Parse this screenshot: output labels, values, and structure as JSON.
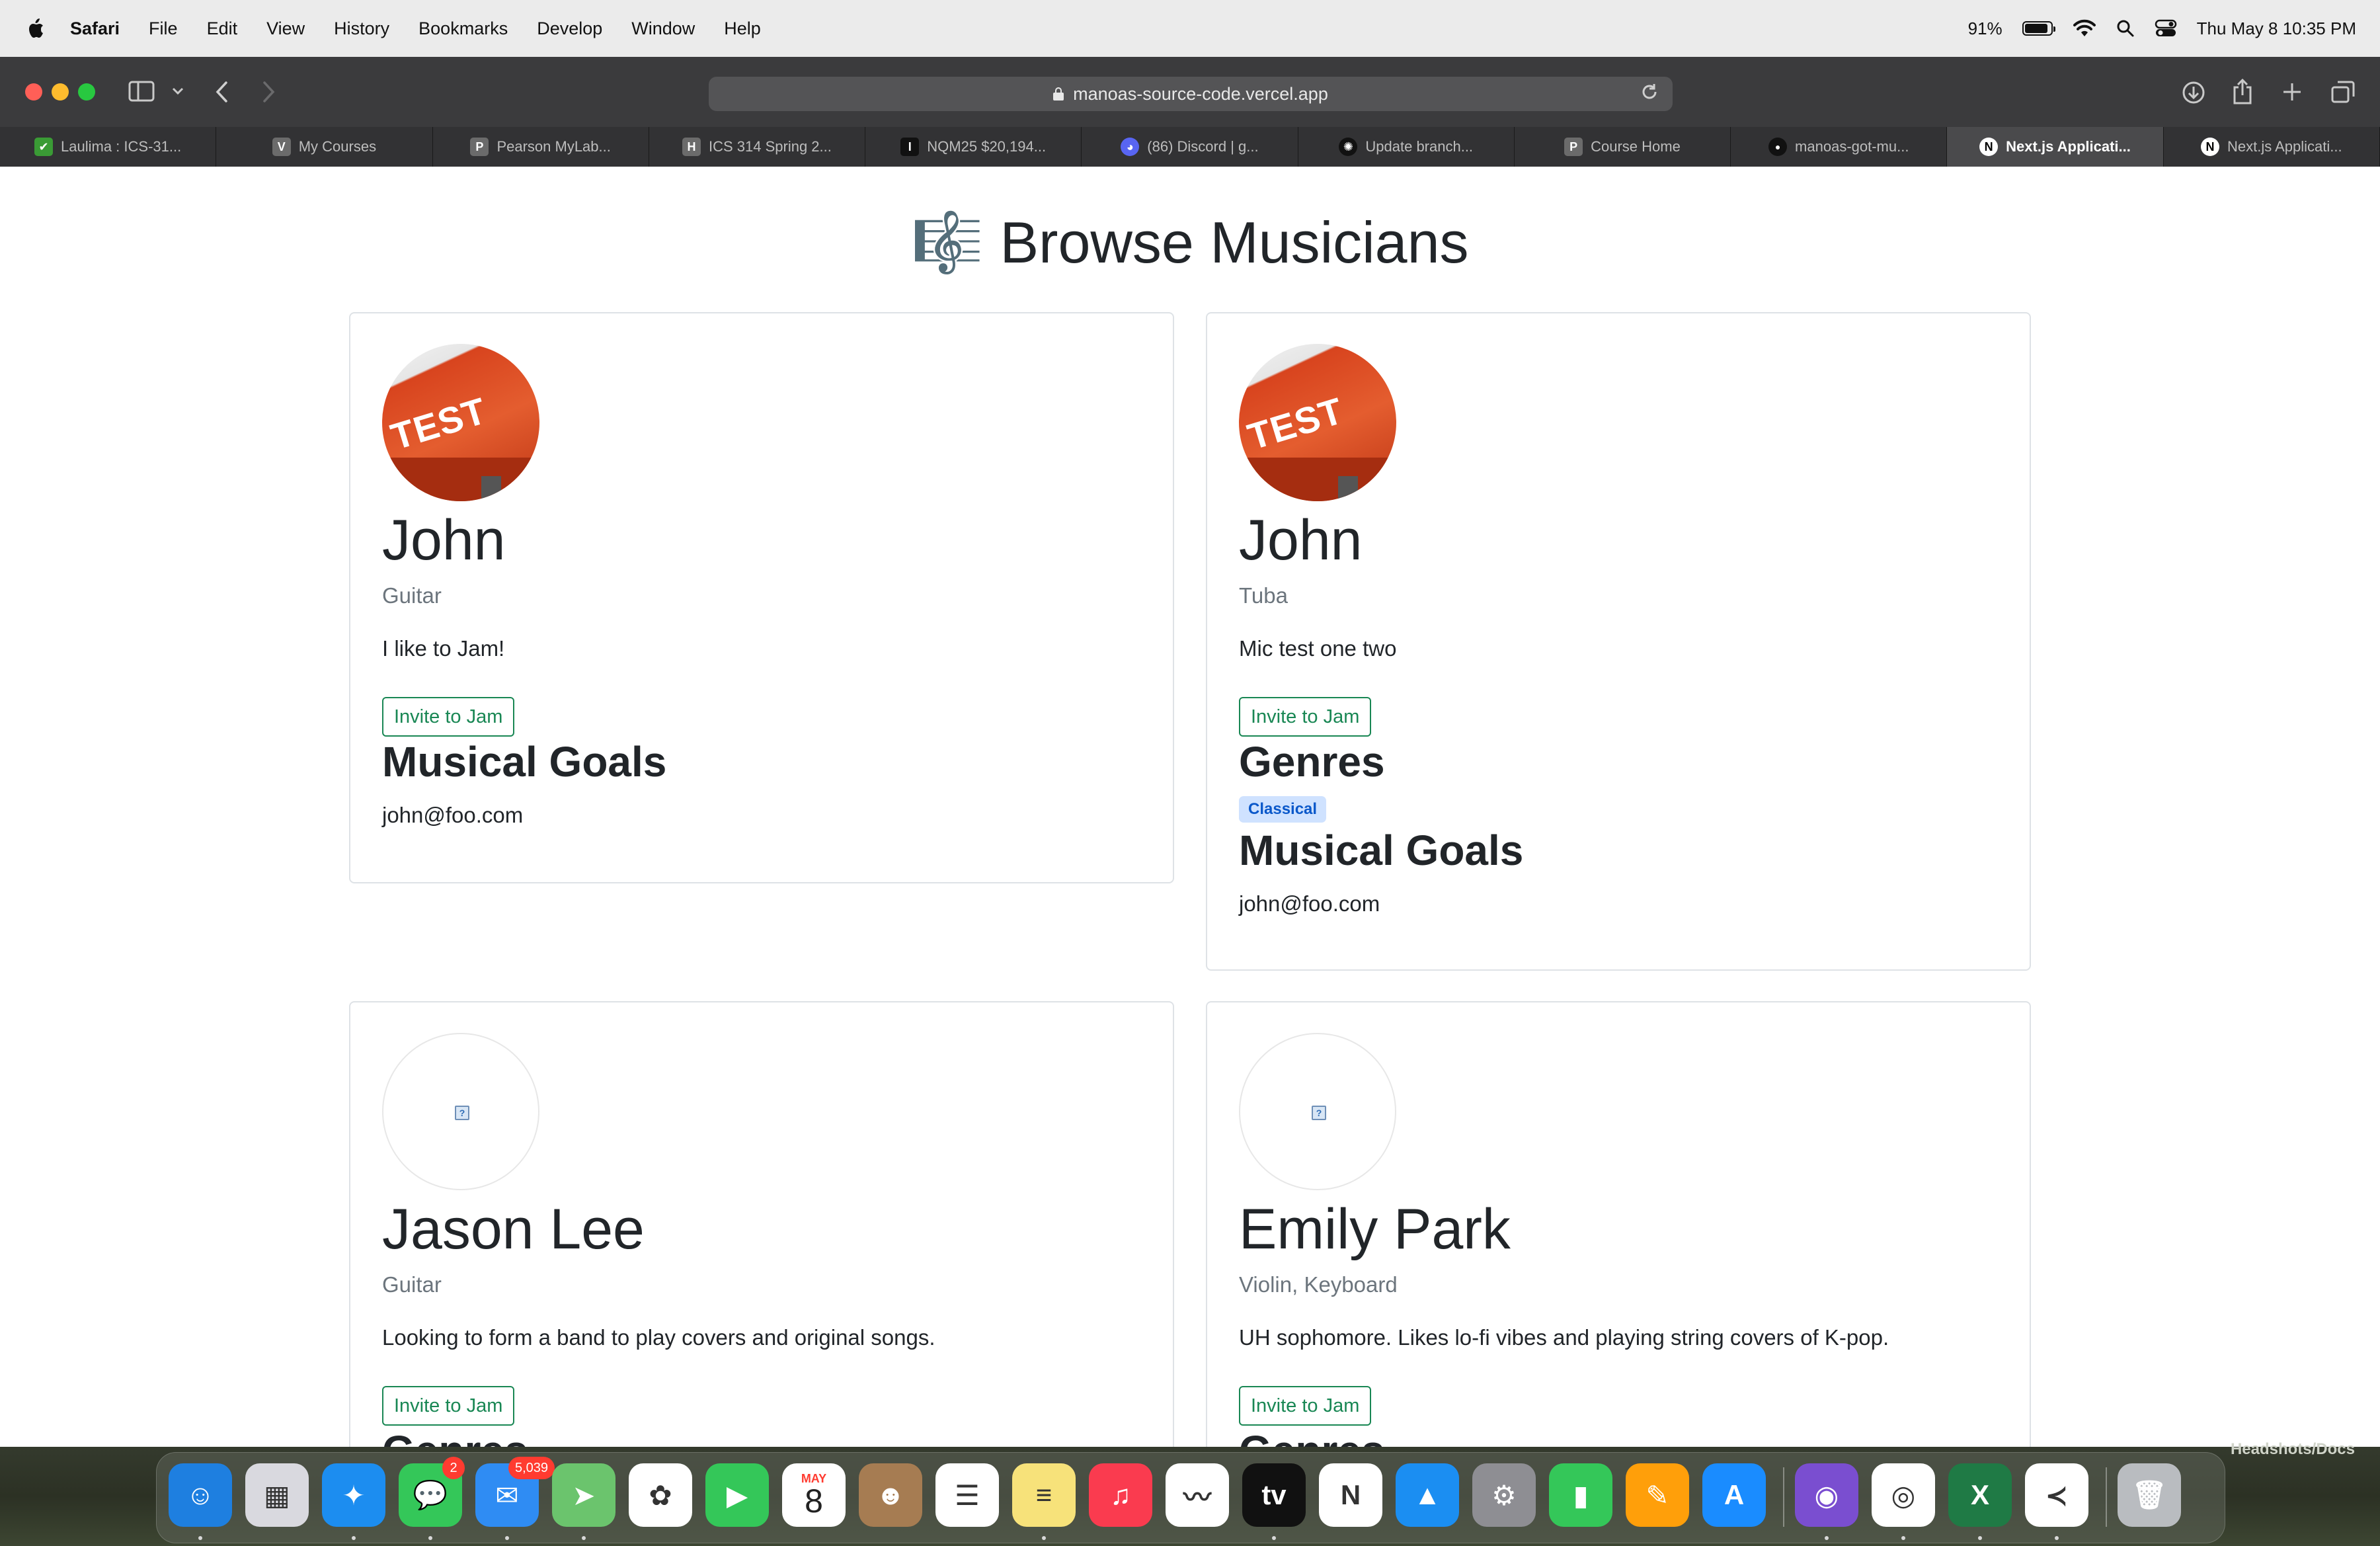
{
  "menubar": {
    "items": [
      "Safari",
      "File",
      "Edit",
      "View",
      "History",
      "Bookmarks",
      "Develop",
      "Window",
      "Help"
    ],
    "battery_percent": "91%",
    "battery_level": 0.91,
    "datetime": "Thu May 8  10:35 PM"
  },
  "browser": {
    "url": "manoas-source-code.vercel.app",
    "tabs": [
      {
        "label": "Laulima : ICS-31...",
        "icon": "leaf-icon",
        "color": "#3a9b35"
      },
      {
        "label": "My Courses",
        "icon": "V",
        "color": "#6b6b6b"
      },
      {
        "label": "Pearson MyLab...",
        "icon": "P",
        "color": "#6b6b6b"
      },
      {
        "label": "ICS 314 Spring 2...",
        "icon": "H",
        "color": "#6b6b6b"
      },
      {
        "label": "NQM25 $20,194...",
        "icon": "I",
        "color": "#111111"
      },
      {
        "label": "(86) Discord | g...",
        "icon": "discord-icon",
        "color": "#5865f2"
      },
      {
        "label": "Update branch...",
        "icon": "openai-icon",
        "color": "#111111"
      },
      {
        "label": "Course Home",
        "icon": "P",
        "color": "#6b6b6b"
      },
      {
        "label": "manoas-got-mu...",
        "icon": "github-icon",
        "color": "#111111"
      },
      {
        "label": "Next.js Applicati...",
        "icon": "nextjs-icon",
        "color": "#111111",
        "active": true
      },
      {
        "label": "Next.js Applicati...",
        "icon": "nextjs-icon",
        "color": "#111111"
      }
    ]
  },
  "page": {
    "title": "🎼 Browse Musicians",
    "cards": [
      {
        "name": "John",
        "instruments": "Guitar",
        "description": "I like to Jam!",
        "invite_label": "Invite to Jam",
        "avatar": "test-image",
        "goals_heading": "Musical Goals",
        "email": "john@foo.com"
      },
      {
        "name": "John",
        "instruments": "Tuba",
        "description": "Mic test one two",
        "invite_label": "Invite to Jam",
        "avatar": "test-image",
        "genres_heading": "Genres",
        "genres": [
          "Classical"
        ],
        "goals_heading": "Musical Goals",
        "email": "john@foo.com"
      },
      {
        "name": "Jason Lee",
        "instruments": "Guitar",
        "description": "Looking to form a band to play covers and original songs.",
        "invite_label": "Invite to Jam",
        "avatar": "broken-image",
        "genres_heading": "Genres"
      },
      {
        "name": "Emily Park",
        "instruments": "Violin, Keyboard",
        "description": "UH sophomore. Likes lo-fi vibes and playing string covers of K-pop.",
        "invite_label": "Invite to Jam",
        "avatar": "broken-image",
        "genres_heading": "Genres"
      }
    ]
  },
  "dock": {
    "caption": "Headshots/Docs",
    "messages_badge": "2",
    "mail_badge": "5,039",
    "calendar_month": "MAY",
    "calendar_day": "8",
    "apps": [
      "finder",
      "launchpad",
      "safari",
      "messages",
      "mail",
      "maps",
      "photos",
      "facetime",
      "calendar",
      "contacts",
      "reminders",
      "notes",
      "music",
      "freeform",
      "apple-tv",
      "news",
      "keynote",
      "system-settings",
      "numbers",
      "pages",
      "app-store",
      "github-desktop",
      "chrome",
      "excel",
      "vscode",
      "trash"
    ]
  },
  "colors": {
    "accent_success": "#198754",
    "badge_bg": "#cfe2ff",
    "badge_text": "#0a58ca"
  }
}
